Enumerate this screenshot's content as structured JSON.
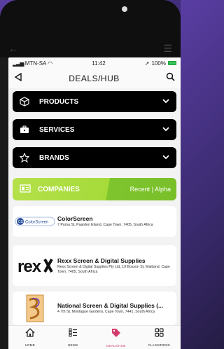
{
  "status": {
    "carrier": "MTN-SA",
    "time": "11:42",
    "battery": "100%"
  },
  "header": {
    "title": "DEALS/HUB",
    "back_icon": "back-triangle-icon",
    "search_icon": "search-icon"
  },
  "menus": [
    {
      "label": "PRODUCTS",
      "icon": "cube-icon"
    },
    {
      "label": "SERVICES",
      "icon": "toolbox-icon"
    },
    {
      "label": "BRANDS",
      "icon": "star-icon"
    }
  ],
  "companies_bar": {
    "label": "COMPANIES",
    "sort": "Recent | Alpha",
    "colors": {
      "light": "#b5e04a",
      "dark": "#7fc52d"
    }
  },
  "companies": [
    {
      "name": "ColorScreen",
      "address": "7 Puma St, Paarden Eiland, Cape Town, 7405, South Africa",
      "logo_text": "ColorScreen",
      "logo_mark": "CS"
    },
    {
      "name": "Rexx Screen & Digital Supplies",
      "address": "Rexx Screen & Digital Supplies Pty Ltd, 19 Bosson St, Maitland, Cape Town, 7405, South Africa",
      "logo_text": "rex"
    },
    {
      "name": "National Screen & Digital Supplies (...",
      "address": "4 7th St, Montague Gardens, Cape Town, 7441, South Africa"
    }
  ],
  "nav": [
    {
      "label": "HOME",
      "icon": "home-icon",
      "active": false
    },
    {
      "label": "NEWS",
      "icon": "news-icon",
      "active": false
    },
    {
      "label": "DEALS/HUB",
      "icon": "tag-icon",
      "active": true
    },
    {
      "label": "CLASSIFIEDS",
      "icon": "grid-icon",
      "active": false
    }
  ],
  "accent": "#d13c6b"
}
